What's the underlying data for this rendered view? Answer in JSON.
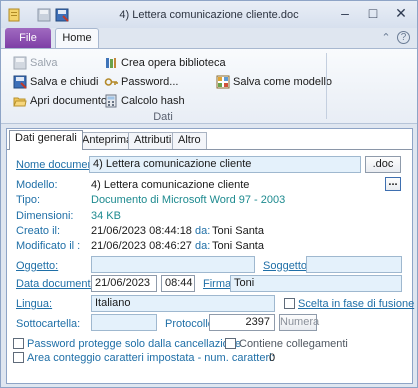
{
  "window": {
    "title": "4) Lettera comunicazione cliente.doc",
    "min_glyph": "–",
    "max_glyph": "□",
    "close_glyph": "✕"
  },
  "ribbon": {
    "tab_file": "File",
    "tab_home": "Home",
    "collapse_glyph": "⌃",
    "help_glyph": "?",
    "save": "Salva",
    "save_close": "Salva e chiudi",
    "open_document": "Apri documento",
    "create_library": "Crea opera biblioteca",
    "password": "Password...",
    "calc_hash": "Calcolo hash",
    "save_as_model": "Salva come modello",
    "group_label": "Dati"
  },
  "tabs": [
    "Dati generali",
    "Anteprima",
    "Attributi",
    "Altro"
  ],
  "form": {
    "doc_name_label": "Nome documento:",
    "doc_name_value": "4) Lettera comunicazione cliente",
    "ext_button": ".doc",
    "model_label": "Modello:",
    "model_value": "4) Lettera comunicazione cliente",
    "browse_button": "...",
    "type_label": "Tipo:",
    "type_value": "Documento di Microsoft Word 97 - 2003",
    "size_label": "Dimensioni:",
    "size_value": "34 KB",
    "created_label": "Creato il:",
    "created_value": "21/06/2023 08:44:18",
    "created_by_label": "da:",
    "created_by_value": "Toni Santa",
    "modified_label": "Modificato il :",
    "modified_value": "21/06/2023 08:46:27",
    "modified_by_label": "da:",
    "modified_by_value": "Toni Santa",
    "object_label": "Oggetto:",
    "object_value": "",
    "subject_label": "Soggetto:",
    "subject_value": "",
    "doc_date_label": "Data documento:",
    "doc_date_value": "21/06/2023",
    "doc_time_value": "08:44",
    "signature_label": "Firma:",
    "signature_value": "Toni",
    "language_label": "Lingua:",
    "language_value": "Italiano",
    "merge_choice_label": "Scelta in fase di fusione",
    "subfolder_label": "Sottocartella:",
    "subfolder_value": "",
    "protocol_label": "Protocollo:",
    "protocol_value": "2397",
    "number_button": "Numera",
    "password_delete_label": "Password protegge solo dalla cancellazione",
    "contains_links_label": "Contiene collegamenti",
    "char_count_label": "Area conteggio caratteri impostata - num. caratteri:",
    "char_count_value": "0"
  },
  "colors": {
    "label_blue": "#1f6fa7",
    "value_teal": "#1d8a8f",
    "field_bg": "#e4f1fb",
    "file_tab": "#7e3fa6"
  }
}
